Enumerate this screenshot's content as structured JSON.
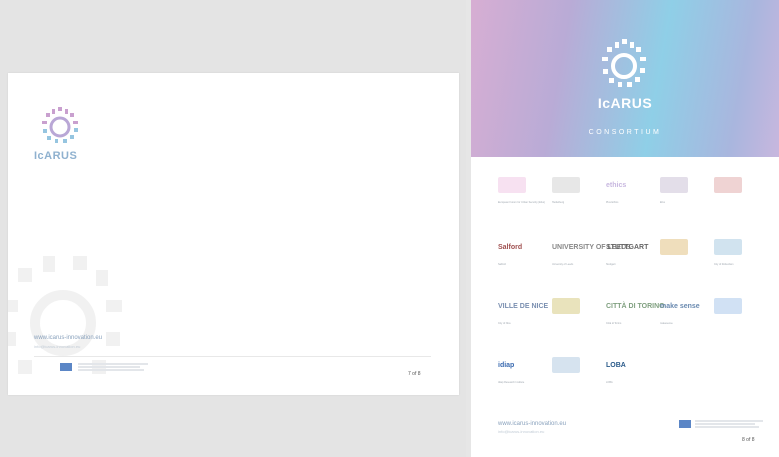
{
  "brand": {
    "wordmark": "IcARUS"
  },
  "page7": {
    "footer_url": "www.icarus-innovation.eu",
    "footer_url_secondary": "info@icarus-innovation.eu",
    "page_number": "7 of 8"
  },
  "page8": {
    "heading": "CONSORTIUM",
    "partners": [
      {
        "logo": "",
        "caption": "European Forum for Urban Security (Efus)"
      },
      {
        "logo": "",
        "caption": "Heidelberg"
      },
      {
        "logo": "ethics",
        "caption": "Plus Ethics"
      },
      {
        "logo": "",
        "caption": "Efus"
      },
      {
        "logo": "",
        "caption": ""
      },
      {
        "logo": "Salford",
        "caption": "Salford"
      },
      {
        "logo": "UNIVERSITY OF LEEDS",
        "caption": "University of Leeds"
      },
      {
        "logo": "STUTTGART",
        "caption": "Stuttgart"
      },
      {
        "logo": "",
        "caption": ""
      },
      {
        "logo": "",
        "caption": "City of Rotterdam"
      },
      {
        "logo": "VILLE DE NICE",
        "caption": "City of Nice"
      },
      {
        "logo": "",
        "caption": ""
      },
      {
        "logo": "CITTÀ DI TORINO",
        "caption": "Città di Torino"
      },
      {
        "logo": "make sense",
        "caption": "makesense"
      },
      {
        "logo": "",
        "caption": ""
      },
      {
        "logo": "idiap",
        "caption": "Idiap Research Institute"
      },
      {
        "logo": "",
        "caption": ""
      },
      {
        "logo": "LOBA",
        "caption": "LOBA"
      }
    ],
    "footer_url": "www.icarus-innovation.eu",
    "footer_url_secondary": "info@icarus-innovation.eu",
    "page_number": "8 of 8"
  },
  "colors": {
    "accent": "#8aa2bd",
    "eu_flag": "#5b86c6"
  }
}
